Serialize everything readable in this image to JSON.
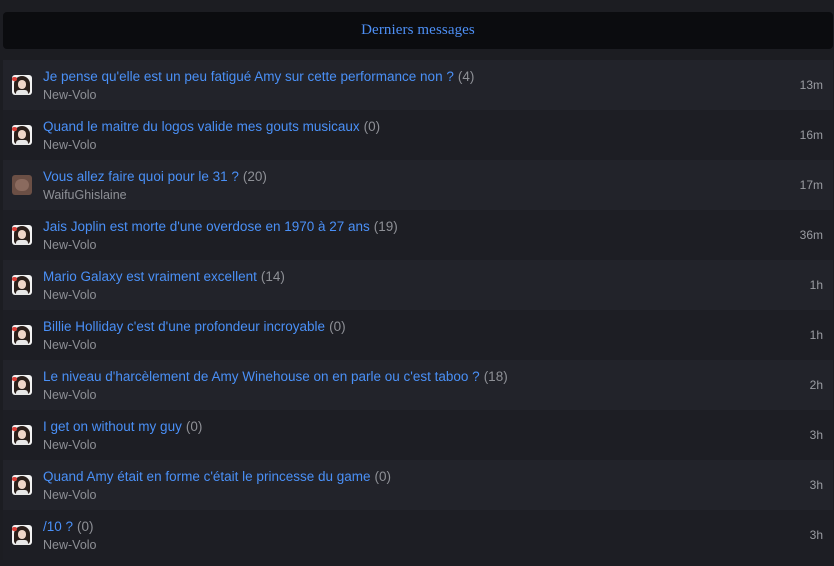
{
  "header": {
    "title": "Derniers messages"
  },
  "topics": [
    {
      "title": "Je pense qu'elle est un peu fatigué Amy sur cette performance non ?",
      "count": "(4)",
      "author": "New-Volo",
      "time": "13m",
      "avatar": "girl-avatar-icon"
    },
    {
      "title": "Quand le maitre du logos valide mes gouts musicaux",
      "count": "(0)",
      "author": "New-Volo",
      "time": "16m",
      "avatar": "girl-avatar-icon"
    },
    {
      "title": "Vous allez faire quoi pour le 31 ?",
      "count": "(20)",
      "author": "WaifuGhislaine",
      "time": "17m",
      "avatar": "brown-avatar-icon"
    },
    {
      "title": "Jais Joplin est morte d'une overdose en 1970 à 27 ans",
      "count": "(19)",
      "author": "New-Volo",
      "time": "36m",
      "avatar": "girl-avatar-icon"
    },
    {
      "title": "Mario Galaxy est vraiment excellent",
      "count": "(14)",
      "author": "New-Volo",
      "time": "1h",
      "avatar": "girl-avatar-icon"
    },
    {
      "title": "Billie Holliday c'est d'une profondeur incroyable",
      "count": "(0)",
      "author": "New-Volo",
      "time": "1h",
      "avatar": "girl-avatar-icon"
    },
    {
      "title": "Le niveau d'harcèlement de Amy Winehouse on en parle ou c'est taboo ?",
      "count": "(18)",
      "author": "New-Volo",
      "time": "2h",
      "avatar": "girl-avatar-icon"
    },
    {
      "title": "I get on without my guy",
      "count": "(0)",
      "author": "New-Volo",
      "time": "3h",
      "avatar": "girl-avatar-icon"
    },
    {
      "title": "Quand Amy était en forme c'était le princesse du game",
      "count": "(0)",
      "author": "New-Volo",
      "time": "3h",
      "avatar": "girl-avatar-icon"
    },
    {
      "title": "/10 ?",
      "count": "(0)",
      "author": "New-Volo",
      "time": "3h",
      "avatar": "girl-avatar-icon"
    }
  ],
  "colors": {
    "link": "#4a90f7",
    "muted": "#8e9096",
    "background": "#1c1d22"
  }
}
